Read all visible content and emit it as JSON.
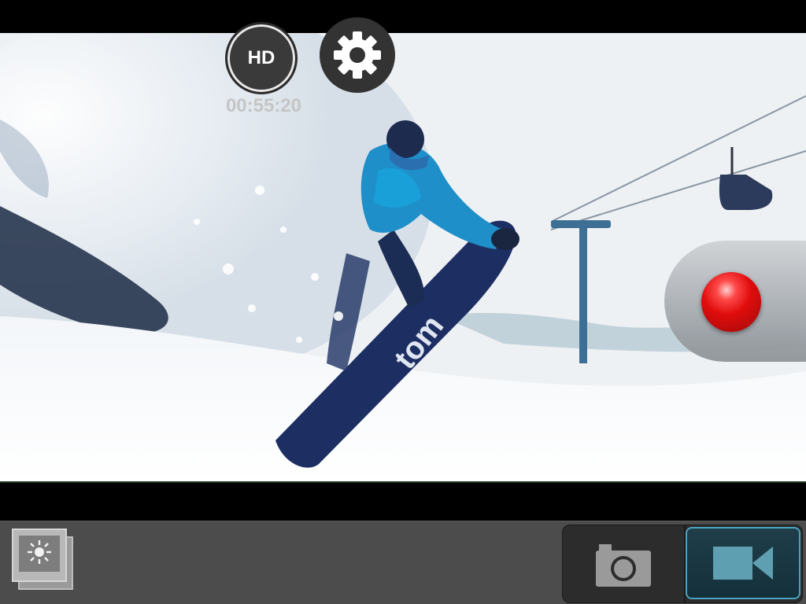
{
  "camera": {
    "hd_label": "HD",
    "recording_time": "00:55:20",
    "mode": "video"
  },
  "icons": {
    "settings": "gear-icon",
    "record": "record-icon",
    "gallery": "gallery-icon",
    "photo_mode": "camera-icon",
    "video_mode": "video-camera-icon"
  },
  "colors": {
    "record_red": "#e00000",
    "active_mode_border": "#4aa3c0",
    "bottom_bar": "#4c4c4c"
  }
}
